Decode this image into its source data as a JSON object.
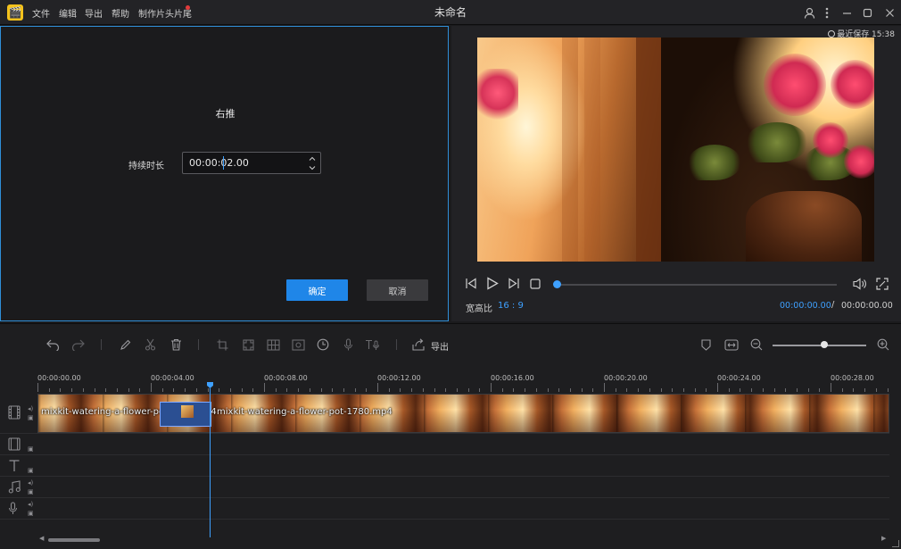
{
  "titlebar": {
    "logo_glyph": "🎬",
    "menu": [
      "文件",
      "编辑",
      "导出",
      "帮助",
      "制作片头片尾"
    ],
    "title": "未命名",
    "controls": [
      "user-icon",
      "more-icon",
      "minimize-icon",
      "maximize-icon",
      "close-icon"
    ]
  },
  "dialog": {
    "title": "右推",
    "duration_label": "持续时长",
    "duration_value": "00:00:02.00",
    "ok_label": "确定",
    "cancel_label": "取消"
  },
  "preview": {
    "last_saved": "最近保存 15:38",
    "aspect_label": "宽高比",
    "aspect_value": "16 : 9",
    "time_current": "00:00:00.00",
    "time_separator": "/",
    "time_total": "00:00:00.00",
    "seek_progress": 0.0
  },
  "toolbar": {
    "export_label": "导出",
    "zoom_level": 0.55
  },
  "timeline": {
    "ticks": [
      "00:00:00.00",
      "00:00:04.00",
      "00:00:08.00",
      "00:00:12.00",
      "00:00:16.00",
      "00:00:20.00",
      "00:00:24.00",
      "00:00:28.00"
    ],
    "clips": [
      {
        "label": "mixkit-watering-a-flower-pot-1780.mp4"
      },
      {
        "label": "mixkit-watering-a-flower-pot-1780.mp4"
      }
    ]
  }
}
